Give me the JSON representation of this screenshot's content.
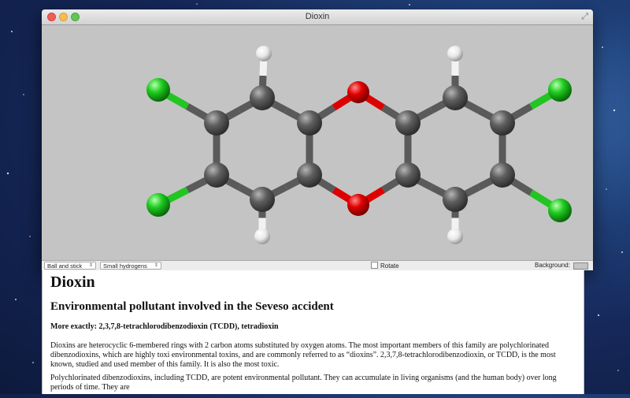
{
  "window": {
    "title": "Dioxin",
    "controls": {
      "close_icon": "close-icon",
      "minimize_icon": "minimize-icon",
      "zoom_icon": "zoom-icon",
      "fullscreen_icon": "fullscreen-icon"
    }
  },
  "viewer": {
    "background_color": "#c4c4c4",
    "atom_colors": {
      "carbon": "#5a5a5a",
      "oxygen": "#dd0000",
      "chlorine": "#22c522",
      "hydrogen": "#f2f2f2"
    }
  },
  "toolbar": {
    "style_select": "Ball and stick",
    "hydrogen_select": "Small hydrogens",
    "rotate_label": "Rotate",
    "rotate_checked": false,
    "background_label": "Background:"
  },
  "document": {
    "title": "Dioxin",
    "subtitle": "Environmental pollutant involved in the Seveso accident",
    "more_exactly": "More exactly: 2,3,7,8-tetrachlorodibenzodioxin (TCDD), tetradioxin",
    "paragraph1": "Dioxins are heterocyclic 6-membered rings with 2 carbon atoms substituted by oxygen atoms. The most important members of this family are polychlorinated dibenzodioxins, which are highly toxi environmental toxins, and are commonly referred to as “dioxins”. 2,3,7,8-tetrachlorodibenzodioxin, or TCDD, is the most known, studied and used member of this family. It is also the most toxic.",
    "paragraph2": "Polychlorinated dibenzodioxins, including TCDD, are potent environmental pollutant. They can accumulate in living organisms (and the human body) over long periods of time. They are"
  }
}
